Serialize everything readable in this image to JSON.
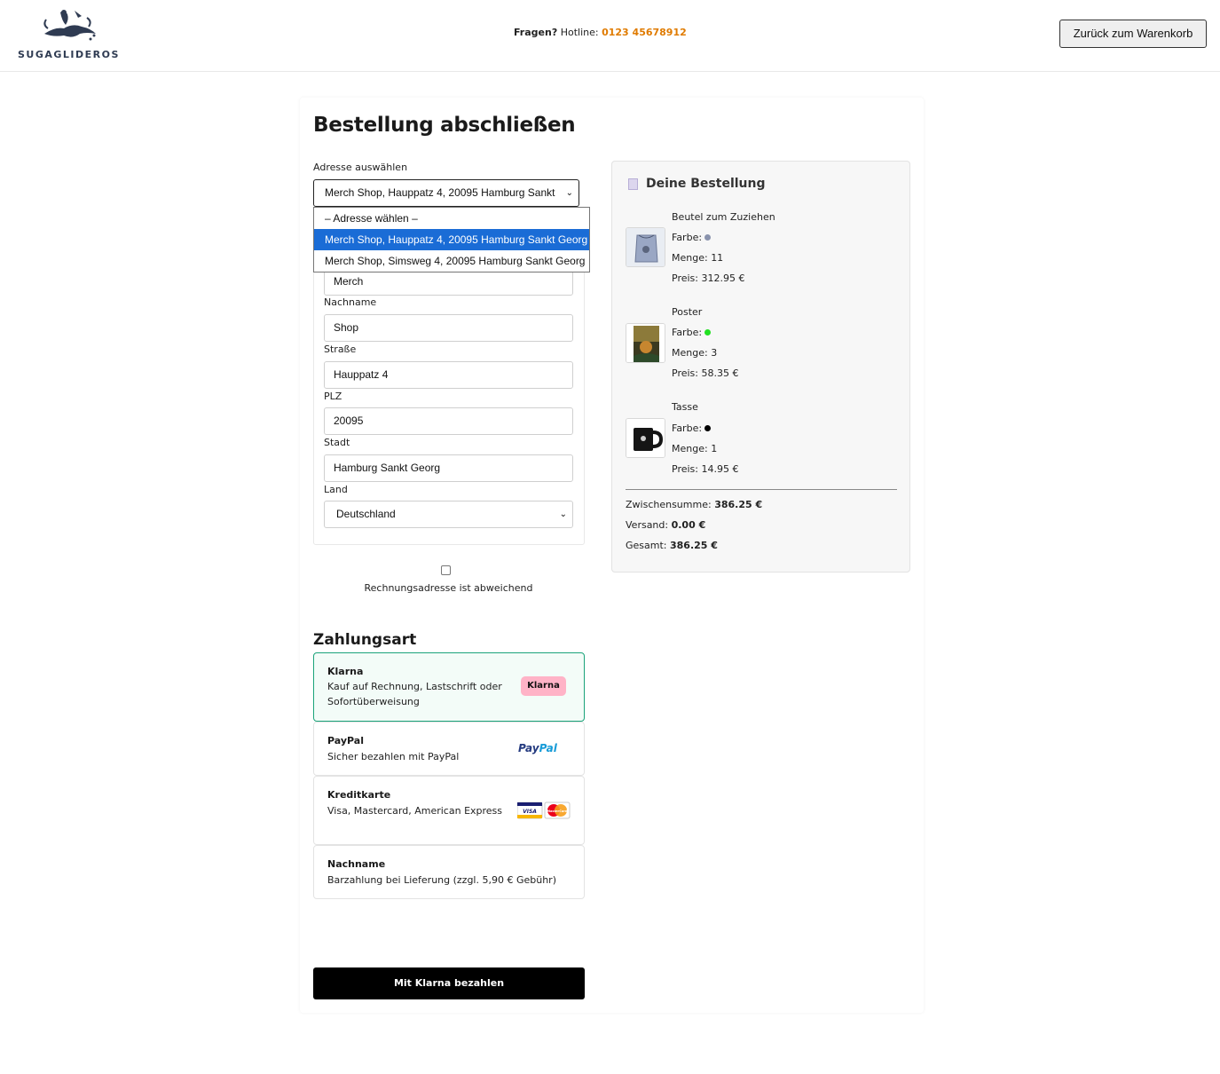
{
  "header": {
    "logo_text": "SUGAGLIDEROS",
    "hotline_question": "Fragen?",
    "hotline_label": "Hotline:",
    "hotline_number": "0123 45678912",
    "back_button": "Zurück zum Warenkorb"
  },
  "checkout": {
    "title": "Bestellung abschließen",
    "address_label": "Adresse auswählen",
    "address_selected": "Merch Shop, Hauppatz 4, 20095 Hamburg Sankt",
    "address_options": [
      "– Adresse wählen –",
      "Merch Shop, Hauppatz 4, 20095 Hamburg Sankt Georg",
      "Merch Shop, Simsweg 4, 20095 Hamburg Sankt Georg"
    ],
    "fields": {
      "first_name_value": "Merch",
      "last_name_label": "Nachname",
      "last_name_value": "Shop",
      "street_label": "Straße",
      "street_value": "Hauppatz 4",
      "zip_label": "PLZ",
      "zip_value": "20095",
      "city_label": "Stadt",
      "city_value": "Hamburg Sankt Georg",
      "country_label": "Land",
      "country_value": "Deutschland"
    },
    "billing_checkbox_label": "Rechnungsadresse ist abweichend",
    "billing_checked": false,
    "payment_title": "Zahlungsart",
    "payment_options": [
      {
        "name": "Klarna",
        "desc": "Kauf auf Rechnung, Lastschrift oder Sofortüberweisung",
        "badge": "Klarna"
      },
      {
        "name": "PayPal",
        "desc": "Sicher bezahlen mit PayPal",
        "logo_a": "Pay",
        "logo_b": "Pal"
      },
      {
        "name": "Kreditkarte",
        "desc": "Visa, Mastercard, American Express",
        "visa": "VISA",
        "mc": "MasterCard"
      },
      {
        "name": "Nachname",
        "desc": "Barzahlung bei Lieferung (zzgl. 5,90 € Gebühr)"
      }
    ],
    "submit_button": "Mit Klarna bezahlen"
  },
  "summary": {
    "title": "Deine Bestellung",
    "color_label": "Farbe:",
    "qty_label": "Menge:",
    "price_label": "Preis:",
    "items": [
      {
        "name": "Beutel zum Zuziehen",
        "color": "#8a93ad",
        "qty": "11",
        "price": "312.95 €"
      },
      {
        "name": "Poster",
        "color": "#22e022",
        "qty": "3",
        "price": "58.35 €"
      },
      {
        "name": "Tasse",
        "color": "#000000",
        "qty": "1",
        "price": "14.95 €"
      }
    ],
    "subtotal_label": "Zwischensumme:",
    "subtotal_value": "386.25 €",
    "shipping_label": "Versand:",
    "shipping_value": "0.00 €",
    "total_label": "Gesamt:",
    "total_value": "386.25 €"
  }
}
